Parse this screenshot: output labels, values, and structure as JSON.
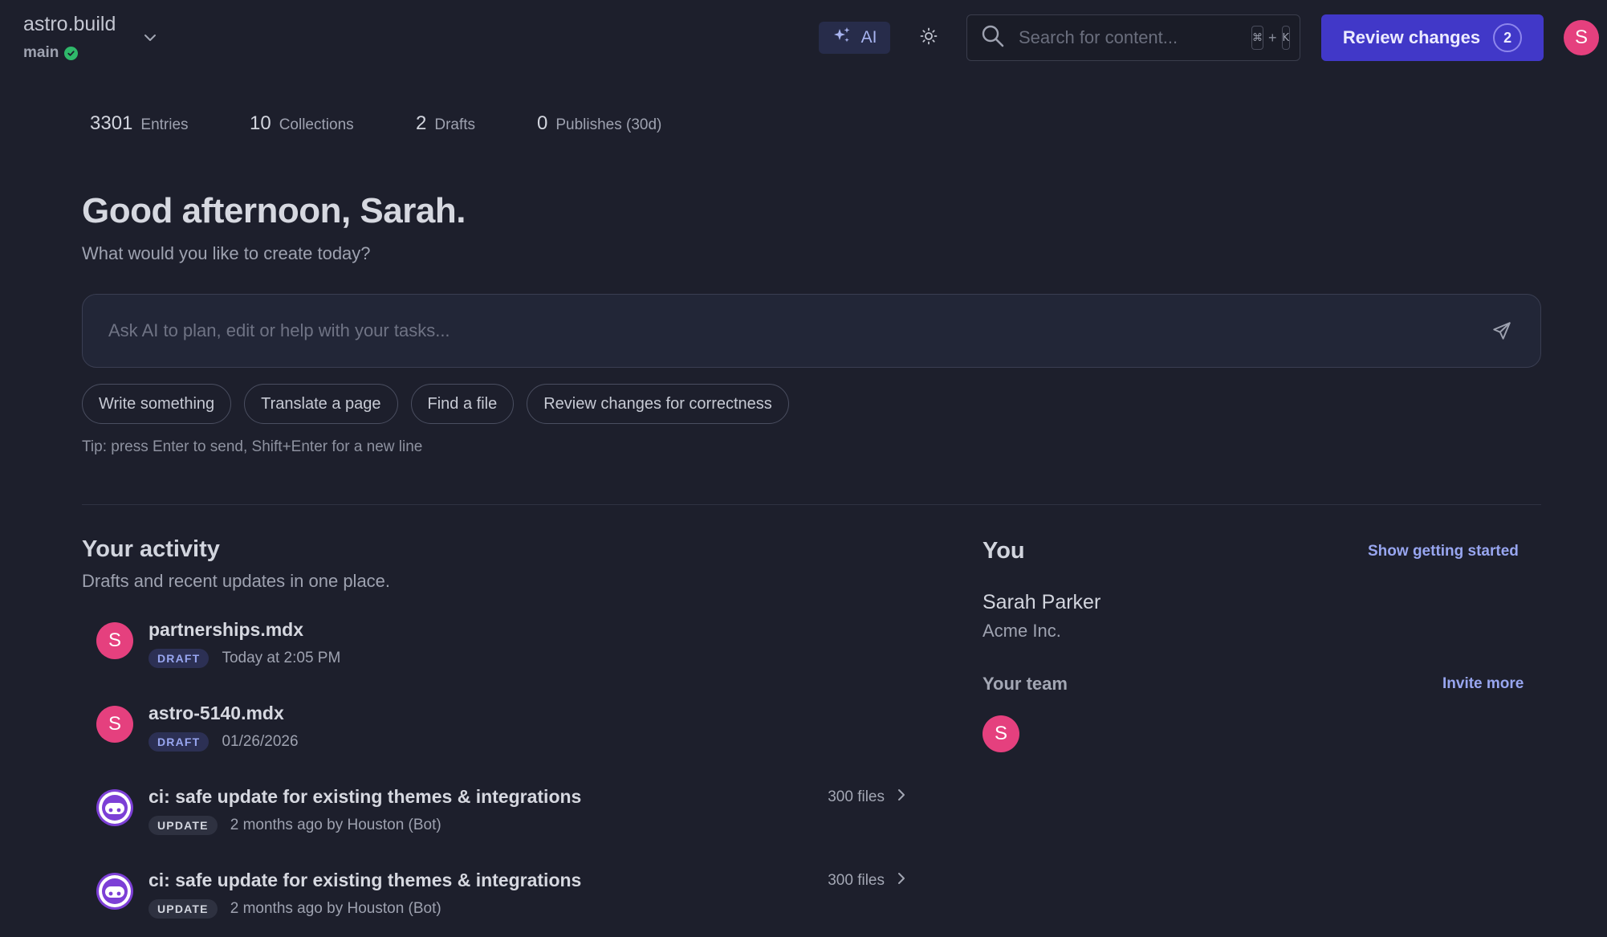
{
  "header": {
    "site_name": "astro.build",
    "branch": "main",
    "ai_label": "AI",
    "search_placeholder": "Search for content...",
    "shortcut_mod": "⌘",
    "shortcut_plus": "+",
    "shortcut_key": "K",
    "review_label": "Review changes",
    "review_count": "2",
    "user_initial": "S"
  },
  "stats": [
    {
      "value": "3301",
      "label": "Entries"
    },
    {
      "value": "10",
      "label": "Collections"
    },
    {
      "value": "2",
      "label": "Drafts"
    },
    {
      "value": "0",
      "label": "Publishes (30d)"
    }
  ],
  "main": {
    "greeting": "Good afternoon, Sarah.",
    "subtitle": "What would you like to create today?",
    "prompt_placeholder": "Ask AI to plan, edit or help with your tasks...",
    "chips": [
      "Write something",
      "Translate a page",
      "Find a file",
      "Review changes for correctness"
    ],
    "tip": "Tip: press Enter to send, Shift+Enter for a new line"
  },
  "activity": {
    "title": "Your activity",
    "subtitle": "Drafts and recent updates in one place.",
    "items": [
      {
        "avatar": "S",
        "name": "partnerships.mdx",
        "badge": "DRAFT",
        "time": "Today at 2:05 PM",
        "files": ""
      },
      {
        "avatar": "S",
        "name": "astro-5140.mdx",
        "badge": "DRAFT",
        "time": "01/26/2026",
        "files": ""
      },
      {
        "avatar": "",
        "name": "ci: safe update for existing themes & integrations",
        "badge": "UPDATE",
        "time": "2 months ago by Houston (Bot)",
        "files": "300 files"
      },
      {
        "avatar": "",
        "name": "ci: safe update for existing themes & integrations",
        "badge": "UPDATE",
        "time": "2 months ago by Houston (Bot)",
        "files": "300 files"
      }
    ]
  },
  "you": {
    "title": "You",
    "show_started": "Show getting started",
    "name": "Sarah Parker",
    "org": "Acme Inc.",
    "team_title": "Your team",
    "invite": "Invite more",
    "team_initial": "S"
  },
  "colors": {
    "background": "#1d1f2c",
    "primary": "#4138c8",
    "avatar": "#e5407e",
    "bot": "#7c3fd6",
    "success": "#2fb86a",
    "link": "#98a6f0"
  }
}
